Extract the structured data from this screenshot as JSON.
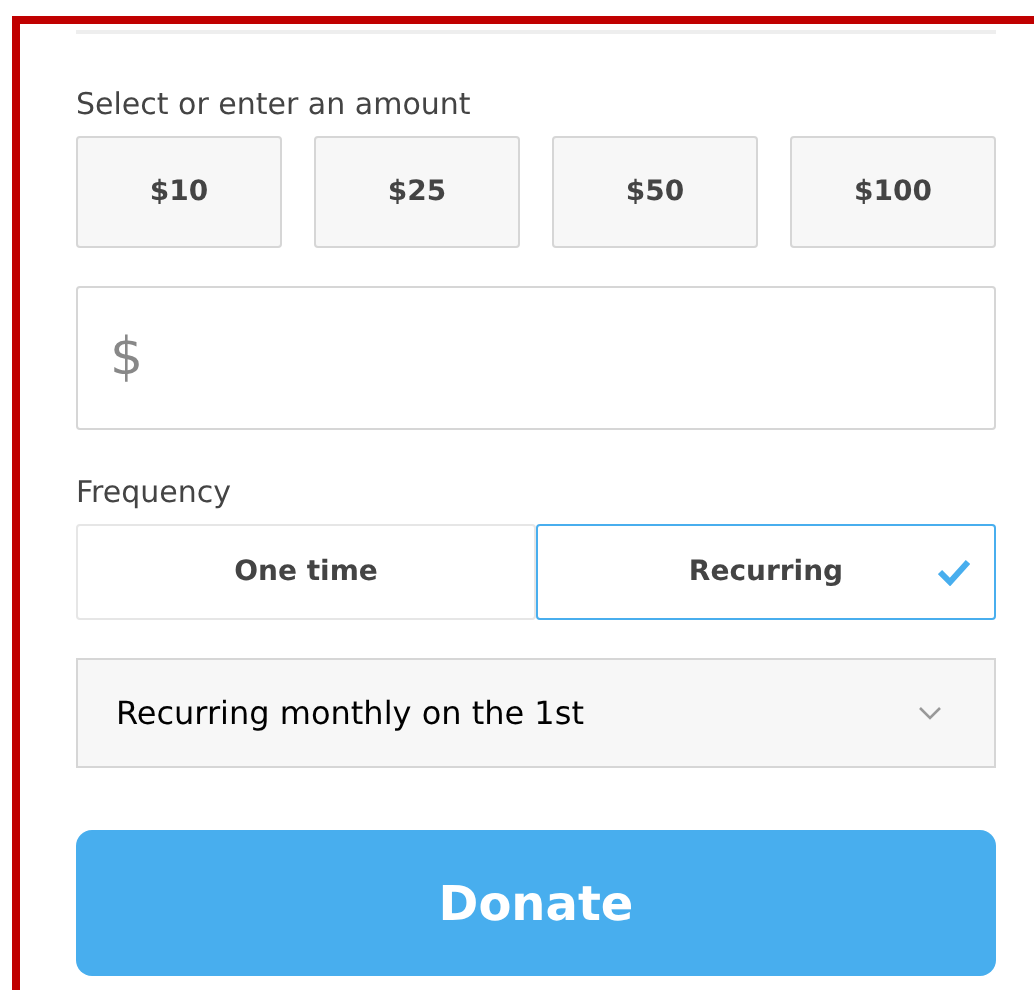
{
  "amount_label": "Select or enter an amount",
  "amounts": [
    {
      "label": "$10",
      "selected": false
    },
    {
      "label": "$25",
      "selected": false
    },
    {
      "label": "$50",
      "selected": false
    },
    {
      "label": "$100",
      "selected": false
    }
  ],
  "custom_amount": {
    "currency_symbol": "$"
  },
  "frequency_label": "Frequency",
  "frequency_options": [
    {
      "label": "One time",
      "selected": false
    },
    {
      "label": "Recurring",
      "selected": true
    }
  ],
  "schedule_select": {
    "value": "Recurring monthly on the 1st"
  },
  "donate_button": "Donate"
}
